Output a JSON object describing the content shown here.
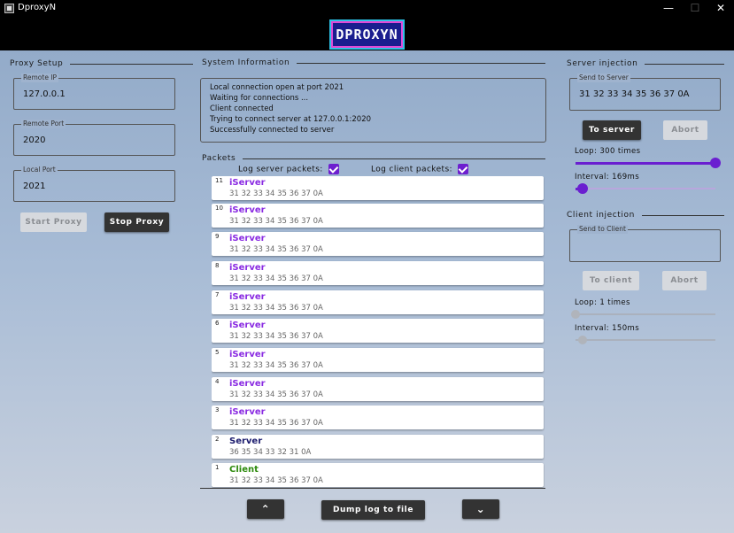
{
  "window": {
    "title": "DproxyN",
    "minimize_glyph": "—",
    "maximize_glyph": "☐",
    "close_glyph": "✕"
  },
  "logo": {
    "text": "DPROXYN"
  },
  "proxy_setup": {
    "title": "Proxy Setup",
    "remote_ip": {
      "label": "Remote IP",
      "value": "127.0.0.1"
    },
    "remote_port": {
      "label": "Remote Port",
      "value": "2020"
    },
    "local_port": {
      "label": "Local Port",
      "value": "2021"
    },
    "start_label": "Start Proxy",
    "stop_label": "Stop Proxy"
  },
  "system_info": {
    "title": "System Information",
    "lines": [
      "Local connection open at port 2021",
      "Waiting for connections ...",
      "Client connected",
      "Trying to connect server at 127.0.0.1:2020",
      "Successfully connected to server"
    ]
  },
  "packets": {
    "title": "Packets",
    "log_server_label": "Log server packets:",
    "log_client_label": "Log client packets:",
    "log_server_checked": true,
    "log_client_checked": true,
    "items": [
      {
        "num": "11",
        "name": "iServer",
        "kind": "iserver",
        "hex": "31 32 33 34 35 36 37 0A"
      },
      {
        "num": "10",
        "name": "iServer",
        "kind": "iserver",
        "hex": "31 32 33 34 35 36 37 0A"
      },
      {
        "num": "9",
        "name": "iServer",
        "kind": "iserver",
        "hex": "31 32 33 34 35 36 37 0A"
      },
      {
        "num": "8",
        "name": "iServer",
        "kind": "iserver",
        "hex": "31 32 33 34 35 36 37 0A"
      },
      {
        "num": "7",
        "name": "iServer",
        "kind": "iserver",
        "hex": "31 32 33 34 35 36 37 0A"
      },
      {
        "num": "6",
        "name": "iServer",
        "kind": "iserver",
        "hex": "31 32 33 34 35 36 37 0A"
      },
      {
        "num": "5",
        "name": "iServer",
        "kind": "iserver",
        "hex": "31 32 33 34 35 36 37 0A"
      },
      {
        "num": "4",
        "name": "iServer",
        "kind": "iserver",
        "hex": "31 32 33 34 35 36 37 0A"
      },
      {
        "num": "3",
        "name": "iServer",
        "kind": "iserver",
        "hex": "31 32 33 34 35 36 37 0A"
      },
      {
        "num": "2",
        "name": "Server",
        "kind": "server",
        "hex": "36 35 34 33 32 31 0A"
      },
      {
        "num": "1",
        "name": "Client",
        "kind": "client",
        "hex": "31 32 33 34 35 36 37 0A"
      }
    ],
    "dump_label": "Dump log to file",
    "scroll_up_glyph": "⌃",
    "scroll_down_glyph": "⌄"
  },
  "server_injection": {
    "title": "Server injection",
    "field_label": "Send to Server",
    "field_value": "31 32 33 34 35 36 37 0A",
    "send_label": "To server",
    "abort_label": "Abort",
    "loop_label": "Loop: 300 times",
    "loop_fraction": 1.0,
    "interval_label": "Interval: 169ms",
    "interval_fraction": 0.05
  },
  "client_injection": {
    "title": "Client injection",
    "field_label": "Send to Client",
    "field_value": "",
    "send_label": "To client",
    "abort_label": "Abort",
    "loop_label": "Loop: 1 times",
    "loop_fraction": 0.0,
    "interval_label": "Interval: 150ms",
    "interval_fraction": 0.05
  },
  "colors": {
    "accent": "#6a1fd0",
    "iserver": "#8a2be2",
    "server": "#1c1c6e",
    "client": "#2d8a0c"
  }
}
